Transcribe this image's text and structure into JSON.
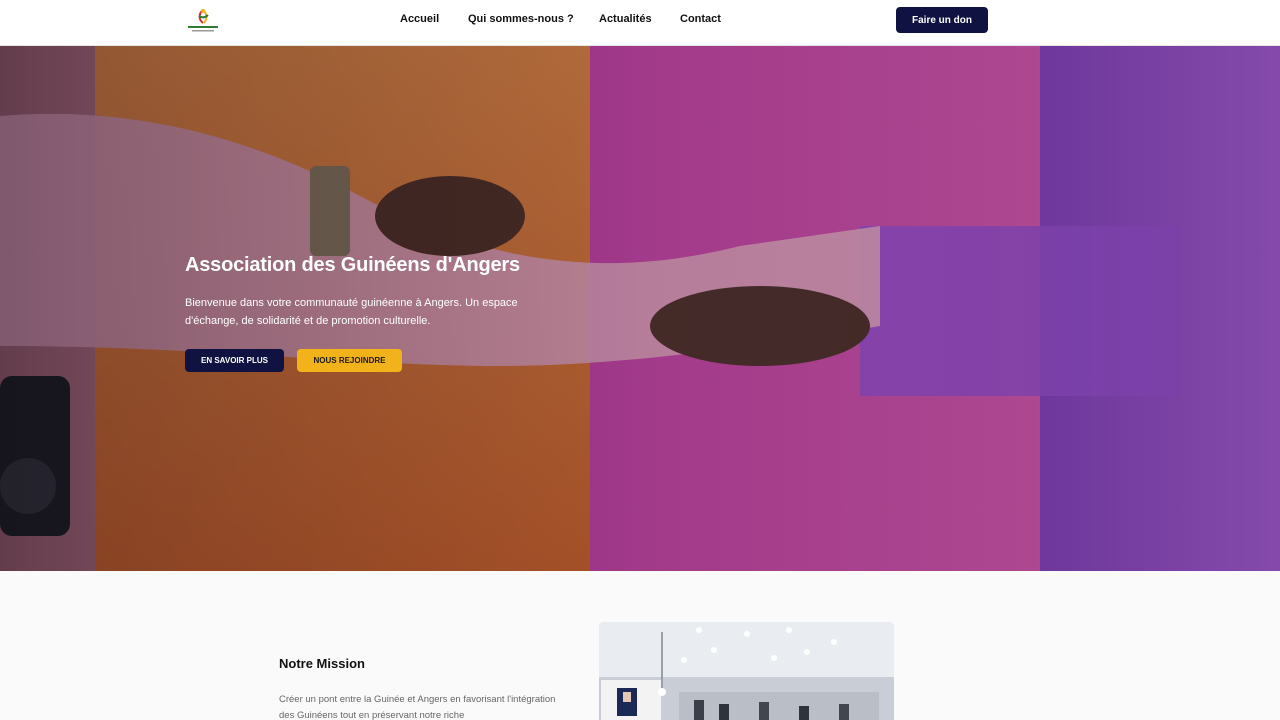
{
  "header": {
    "nav": [
      "Accueil",
      "Qui sommes-nous ?",
      "Actualités",
      "Contact"
    ],
    "donate_label": "Faire un don"
  },
  "hero": {
    "title": "Association des Guinéens d'Angers",
    "subtitle": "Bienvenue dans votre communauté guinéenne à Angers. Un espace d'échange, de solidarité et de promotion culturelle.",
    "cta_primary": "EN SAVOIR PLUS",
    "cta_secondary": "NOUS REJOINDRE"
  },
  "mission": {
    "title": "Notre Mission",
    "text": "Créer un pont entre la Guinée et Angers en favorisant l'intégration des Guinéens tout en préservant notre riche"
  },
  "colors": {
    "navy": "#101342",
    "gold": "#f2b31a"
  },
  "icons": {
    "logo": "association-logo"
  }
}
